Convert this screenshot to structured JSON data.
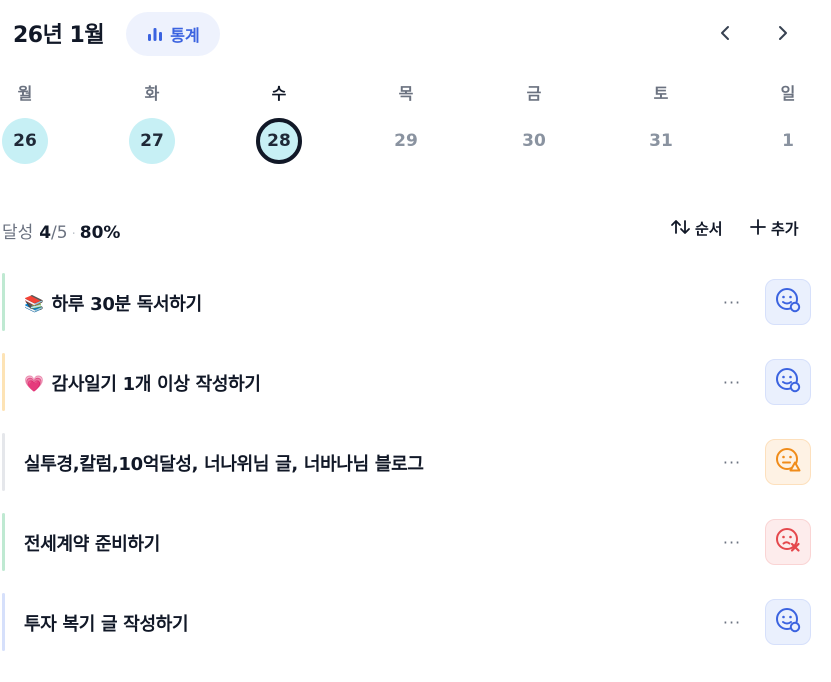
{
  "header": {
    "month_title": "26년 1월",
    "stats_label": "통계",
    "prev_icon": "chevron-left-icon",
    "next_icon": "chevron-right-icon"
  },
  "week": {
    "days": [
      {
        "weekday": "월",
        "date": "26",
        "state": "done"
      },
      {
        "weekday": "화",
        "date": "27",
        "state": "done"
      },
      {
        "weekday": "수",
        "date": "28",
        "state": "today"
      },
      {
        "weekday": "목",
        "date": "29",
        "state": "future"
      },
      {
        "weekday": "금",
        "date": "30",
        "state": "future"
      },
      {
        "weekday": "토",
        "date": "31",
        "state": "future"
      },
      {
        "weekday": "일",
        "date": "1",
        "state": "future"
      }
    ]
  },
  "summary": {
    "label": "달성",
    "done": "4",
    "total": "/5",
    "percent": "80%",
    "sort_label": "순서",
    "add_label": "추가"
  },
  "tasks": [
    {
      "emoji": "📚",
      "title": "하루 30분 독서하기",
      "status": "done",
      "bar_color": "#bfe9d2",
      "more_label": "···"
    },
    {
      "emoji": "💗",
      "title": "감사일기 1개 이상 작성하기",
      "status": "done",
      "bar_color": "#fde3b5",
      "more_label": "···"
    },
    {
      "emoji": "",
      "title": "실투경,칼럼,10억달성, 너나위님 글, 너바나님 블로그",
      "status": "warn",
      "bar_color": "#e5e7eb",
      "more_label": "···"
    },
    {
      "emoji": "",
      "title": "전세계약 준비하기",
      "status": "fail",
      "bar_color": "#bfe9d2",
      "more_label": "···"
    },
    {
      "emoji": "",
      "title": "투자 복기 글 작성하기",
      "status": "done",
      "bar_color": "#d6e0fb",
      "more_label": "···"
    }
  ],
  "colors": {
    "accent": "#3b63e0",
    "date_done_bg": "#c7f0f5",
    "status_done": "#3b63e0",
    "status_warn": "#f08c1a",
    "status_fail": "#e5484d"
  }
}
